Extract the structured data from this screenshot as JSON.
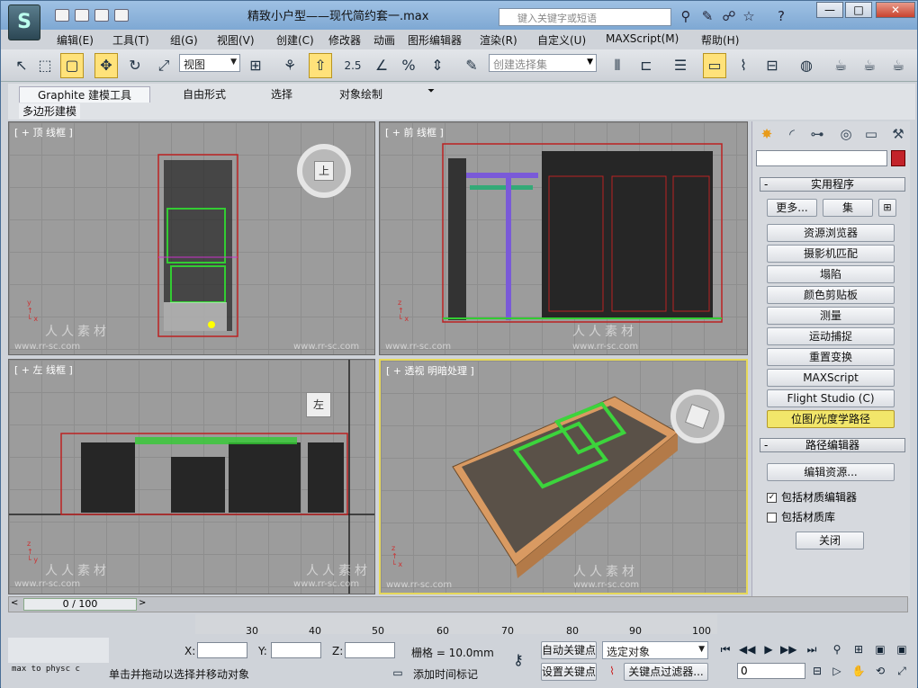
{
  "window": {
    "title": "精致小户型——现代简约套一.max",
    "search_placeholder": "键入关键字或短语",
    "min": "—",
    "max": "□",
    "close": "✕"
  },
  "menu": [
    "编辑(E)",
    "工具(T)",
    "组(G)",
    "视图(V)",
    "创建(C)",
    "修改器",
    "动画",
    "图形编辑器",
    "渲染(R)",
    "自定义(U)",
    "MAXScript(M)",
    "帮助(H)"
  ],
  "toolbar": {
    "view_dropdown": "视图",
    "selection_set_placeholder": "创建选择集",
    "snap_label": "2.5"
  },
  "ribbon": {
    "tabs": [
      "Graphite 建模工具",
      "自由形式",
      "选择",
      "对象绘制"
    ],
    "sub": "多边形建模"
  },
  "viewports": {
    "top": "[ + 顶 线框 ]",
    "front": "[ + 前 线框 ]",
    "left": "[ + 左 线框 ]",
    "persp": "[ + 透视 明暗处理 ]",
    "cube_top": "上",
    "cube_left": "左"
  },
  "watermark": {
    "text": "人人素材",
    "url": "www.rr-sc.com"
  },
  "command_panel": {
    "utilities_title": "实用程序",
    "more": "更多...",
    "sets": "集",
    "buttons": [
      "资源浏览器",
      "摄影机匹配",
      "塌陷",
      "颜色剪贴板",
      "测量",
      "运动捕捉",
      "重置变换",
      "MAXScript",
      "Flight Studio (C)",
      "位图/光度学路径"
    ],
    "path_editor_title": "路径编辑器",
    "edit_resources": "编辑资源...",
    "include_mat_editor": "包括材质编辑器",
    "include_mat_library": "包括材质库",
    "close": "关闭",
    "include_mat_editor_checked": true,
    "include_mat_library_checked": false
  },
  "timeline": {
    "frame": "0 / 100",
    "ticks": [
      "30",
      "40",
      "50",
      "60",
      "70",
      "80",
      "90",
      "100"
    ]
  },
  "status": {
    "x_label": "X:",
    "y_label": "Y:",
    "z_label": "Z:",
    "grid": "栅格 = 10.0mm",
    "auto_key": "自动关键点",
    "set_key": "设置关键点",
    "selected_object": "选定对象",
    "key_filters": "关键点过滤器...",
    "frame_value": "0",
    "prompt": "单击并拖动以选择并移动对象",
    "add_time_tag": "添加时间标记",
    "maxscript_listener": "max to physc c"
  }
}
